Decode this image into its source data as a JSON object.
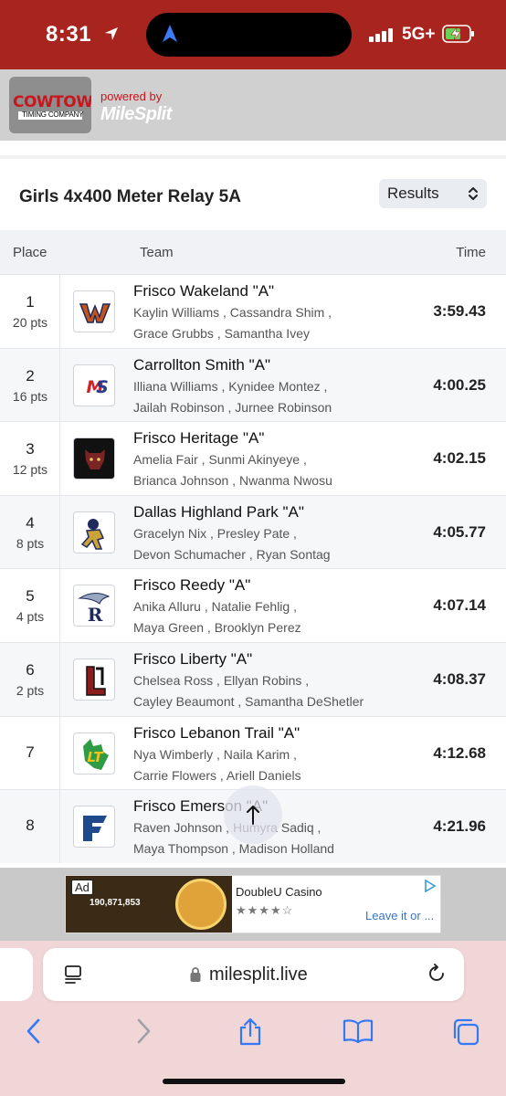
{
  "status_bar": {
    "time": "8:31",
    "network": "5G+"
  },
  "header": {
    "logo_text": "COWTOWN",
    "logo_subtext": "TIMING COMPANY",
    "powered_by": "powered by",
    "brand": "MileSplit"
  },
  "event": {
    "title": "Girls 4x400 Meter Relay 5A",
    "view_select": "Results"
  },
  "table": {
    "headers": {
      "place": "Place",
      "team": "Team",
      "time": "Time"
    },
    "rows": [
      {
        "place": "1",
        "pts": "20 pts",
        "team": "Frisco Wakeland \"A\"",
        "runners1": "Kaylin Williams , Cassandra Shim ,",
        "runners2": "Grace Grubbs , Samantha Ivey",
        "time": "3:59.43"
      },
      {
        "place": "2",
        "pts": "16 pts",
        "team": "Carrollton Smith \"A\"",
        "runners1": "Illiana Williams , Kynidee Montez ,",
        "runners2": "Jailah Robinson , Jurnee Robinson",
        "time": "4:00.25"
      },
      {
        "place": "3",
        "pts": "12 pts",
        "team": "Frisco Heritage \"A\"",
        "runners1": "Amelia Fair , Sunmi Akinyeye ,",
        "runners2": "Brianca Johnson , Nwanma Nwosu",
        "time": "4:02.15"
      },
      {
        "place": "4",
        "pts": "8 pts",
        "team": "Dallas Highland Park \"A\"",
        "runners1": "Gracelyn Nix , Presley Pate ,",
        "runners2": "Devon Schumacher , Ryan Sontag",
        "time": "4:05.77"
      },
      {
        "place": "5",
        "pts": "4 pts",
        "team": "Frisco Reedy \"A\"",
        "runners1": "Anika Alluru , Natalie Fehlig ,",
        "runners2": "Maya Green , Brooklyn Perez",
        "time": "4:07.14"
      },
      {
        "place": "6",
        "pts": "2 pts",
        "team": "Frisco Liberty \"A\"",
        "runners1": "Chelsea Ross , Ellyan Robins ,",
        "runners2": "Cayley Beaumont , Samantha DeShetler",
        "time": "4:08.37"
      },
      {
        "place": "7",
        "pts": "",
        "team": "Frisco Lebanon Trail \"A\"",
        "runners1": "Nya Wimberly , Naila Karim ,",
        "runners2": "Carrie Flowers , Ariell Daniels",
        "time": "4:12.68"
      },
      {
        "place": "8",
        "pts": "",
        "team": "Frisco Emerson \"A\"",
        "runners1": "Raven Johnson , Humyra Sadiq ,",
        "runners2": "Maya Thompson , Madison Holland",
        "time": "4:21.96"
      }
    ]
  },
  "ad": {
    "badge": "Ad",
    "image_text": "190,871,853",
    "name": "DoubleU Casino",
    "rating": "★★★★☆",
    "link": "Leave it or ..."
  },
  "browser": {
    "url": "milesplit.live"
  },
  "colors": {
    "status_bar": "#a8241f",
    "brand_red": "#c8161d",
    "browser_blue": "#3478f6"
  }
}
